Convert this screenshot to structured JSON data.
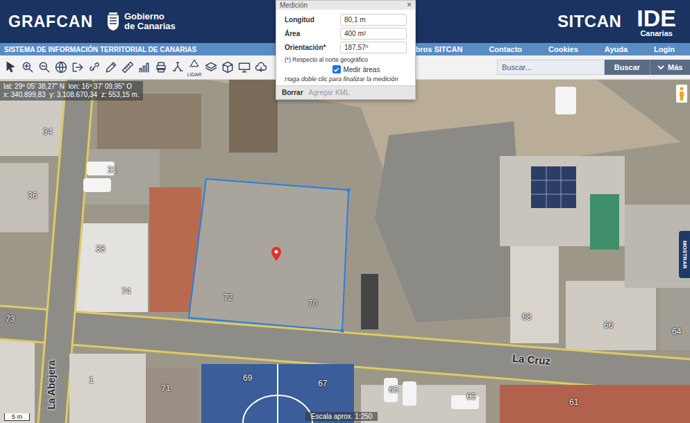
{
  "header": {
    "brand": "GRAFCAN",
    "government": [
      "Gobierno",
      "de Canarias"
    ],
    "sitcan": "SITCAN",
    "ide": "IDE",
    "ide_region": "Canarias"
  },
  "nav": {
    "title": "SISTEMA DE INFORMACIÓN TERRITORIAL DE CANARIAS",
    "links": [
      "Miembros SITCAN",
      "Contacto",
      "Cookies",
      "Ayuda",
      "Login"
    ]
  },
  "toolbar": {
    "lidar_label": "LIDAR",
    "search": {
      "placeholder": "Buscar...",
      "button": "Buscar",
      "more": "Más"
    }
  },
  "coordinates": {
    "geographic": "lat: 29º 05' 38,27\" N  lon: 16º 37' 09,95\" O",
    "projected": "x: 340.899,83  y: 3.108.670,34  z: 553,15 m."
  },
  "measurement": {
    "title": "Medición",
    "close": "×",
    "fields": [
      {
        "label": "Longitud",
        "value": "80,1 m"
      },
      {
        "label": "Área",
        "value": "400 m²"
      },
      {
        "label": "Orientación*",
        "value": "187,57º"
      }
    ],
    "note": "(*) Respecto al norte geográfico",
    "measure_areas": {
      "label": "Medir áreas",
      "checked": true
    },
    "hint": "Haga doble clic para finalizar la medición",
    "actions": [
      {
        "label": "Borrar",
        "disabled": false
      },
      {
        "label": "Agregar KML",
        "disabled": true
      }
    ]
  },
  "map": {
    "streets": [
      "La Cruz",
      "La Abejera"
    ],
    "parcels": [
      "34",
      "31",
      "36",
      "33",
      "74",
      "73",
      "72",
      "70",
      "68",
      "66",
      "64",
      "1",
      "71",
      "69",
      "67",
      "65",
      "63",
      "61"
    ],
    "scale": "5 m",
    "scale_ratio": "Escala aprox. 1:250",
    "side_tab": "MOSTRAR"
  }
}
